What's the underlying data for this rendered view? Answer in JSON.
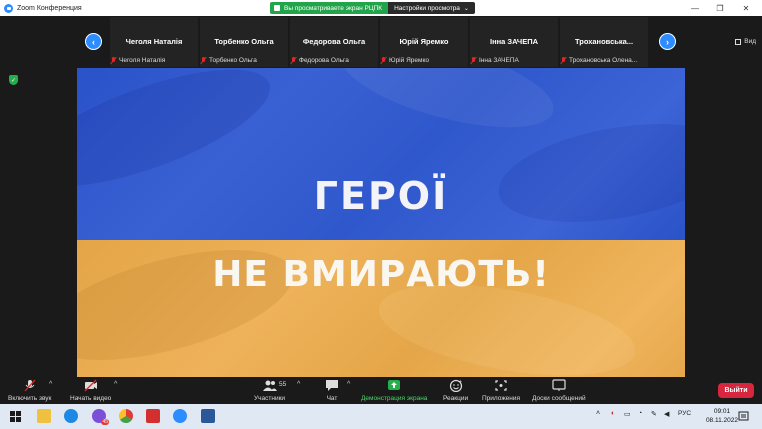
{
  "window": {
    "title": "Zoom Конференция",
    "share_status": "Вы просматриваете экран РЦПК",
    "view_options": "Настройки просмотра"
  },
  "participants": [
    {
      "name": "Чеголя Наталія",
      "label": "Чеголя Наталія"
    },
    {
      "name": "Торбенко Ольга",
      "label": "Торбенко Ольга"
    },
    {
      "name": "Федорова Ольга",
      "label": "Федорова Ольга"
    },
    {
      "name": "Юрій Яремко",
      "label": "Юрій Яремко"
    },
    {
      "name": "Інна ЗАЧЕПА",
      "label": "Інна ЗАЧЕПА"
    },
    {
      "name": "Трохановська...",
      "label": "Трохановська Олена..."
    }
  ],
  "view_label": "Вид",
  "shared_screen": {
    "line1": "ГЕРОЇ",
    "line2": "НЕ ВМИРАЮТЬ!",
    "colors": {
      "top": "#3159cd",
      "bottom": "#e9ab50"
    }
  },
  "toolbar": {
    "unmute": "Включить звук",
    "start_video": "Начать видео",
    "participants": "Участники",
    "participants_count": "55",
    "chat": "Чат",
    "share_screen": "Демонстрация экрана",
    "reactions": "Реакции",
    "apps": "Приложения",
    "whiteboards": "Доски сообщений",
    "leave": "Выйти"
  },
  "taskbar": {
    "language": "РУС",
    "time": "09:01",
    "date": "08.11.2022",
    "notification_badge": "45"
  },
  "colors": {
    "accent": "#2d8cff",
    "share_green": "#22a44a",
    "leave_red": "#d7263d"
  }
}
